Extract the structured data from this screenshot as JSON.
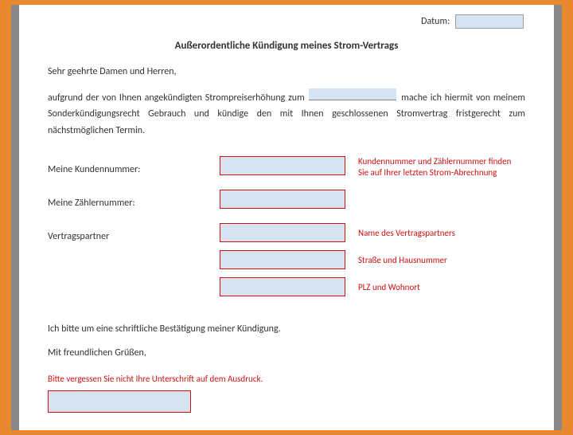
{
  "header": {
    "date_label": "Datum:"
  },
  "title": "Außerordentliche Kündigung meines Strom-Vertrags",
  "salutation": "Sehr geehrte Damen und Herren,",
  "paragraph": {
    "part1": "aufgrund der von Ihnen angekündigten Strompreiserhöhung zum ",
    "part2": " mache ich hiermit von meinem Sonderkündigungsrecht Gebrauch und kündige den mit Ihnen geschlossenen Stromvertrag fristgerecht zum nächstmöglichen Termin."
  },
  "labels": {
    "kundennummer": "Meine Kundennummer:",
    "zaehlernummer": "Meine Zählernummer:",
    "vertragspartner": "Vertragspartner"
  },
  "hints": {
    "kn_zn": "Kundennummer und Zählernummer finden Sie auf Ihrer letzten Strom-Abrechnung",
    "partner_name": "Name des Vertragspartners",
    "partner_street": "Straße und Hausnummer",
    "partner_city": "PLZ und Wohnort"
  },
  "confirm": "Ich bitte um eine schriftliche Bestätigung meiner Kündigung.",
  "closing": "Mit freundlichen Grüßen,",
  "signature_hint": "Bitte vergessen Sie nicht Ihre Unterschrift auf dem Ausdruck.",
  "watermark": ""
}
